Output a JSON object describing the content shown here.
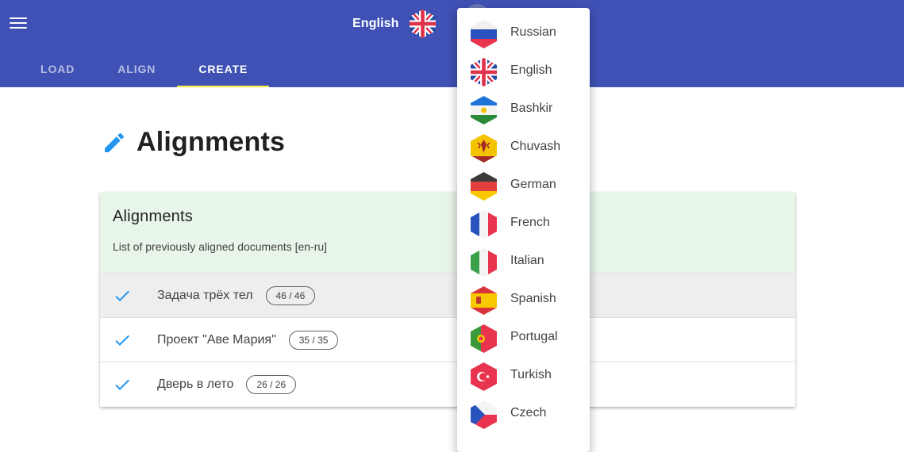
{
  "header": {
    "current_language": "English",
    "tabs": [
      {
        "label": "LOAD",
        "active": false
      },
      {
        "label": "ALIGN",
        "active": false
      },
      {
        "label": "CREATE",
        "active": true
      }
    ]
  },
  "page": {
    "title": "Alignments"
  },
  "card": {
    "title": "Alignments",
    "subtitle": "List of previously aligned documents [en-ru]",
    "rows": [
      {
        "title": "Задача трёх тел",
        "count": "46 / 46",
        "selected": true
      },
      {
        "title": "Проект \"Аве Мария\"",
        "count": "35 / 35",
        "selected": false
      },
      {
        "title": "Дверь в лето",
        "count": "26 / 26",
        "selected": false
      }
    ]
  },
  "language_menu": {
    "items": [
      {
        "label": "Russian",
        "flag": "ru"
      },
      {
        "label": "English",
        "flag": "gb"
      },
      {
        "label": "Bashkir",
        "flag": "ba"
      },
      {
        "label": "Chuvash",
        "flag": "cv"
      },
      {
        "label": "German",
        "flag": "de"
      },
      {
        "label": "French",
        "flag": "fr"
      },
      {
        "label": "Italian",
        "flag": "it"
      },
      {
        "label": "Spanish",
        "flag": "es"
      },
      {
        "label": "Portugal",
        "flag": "pt"
      },
      {
        "label": "Turkish",
        "flag": "tr"
      },
      {
        "label": "Czech",
        "flag": "cz"
      }
    ]
  },
  "colors": {
    "app_bar": "#3f51b5",
    "tab_indicator": "#ffeb3b",
    "card_header": "#e8f5e9",
    "accent_blue": "#2196f3"
  }
}
